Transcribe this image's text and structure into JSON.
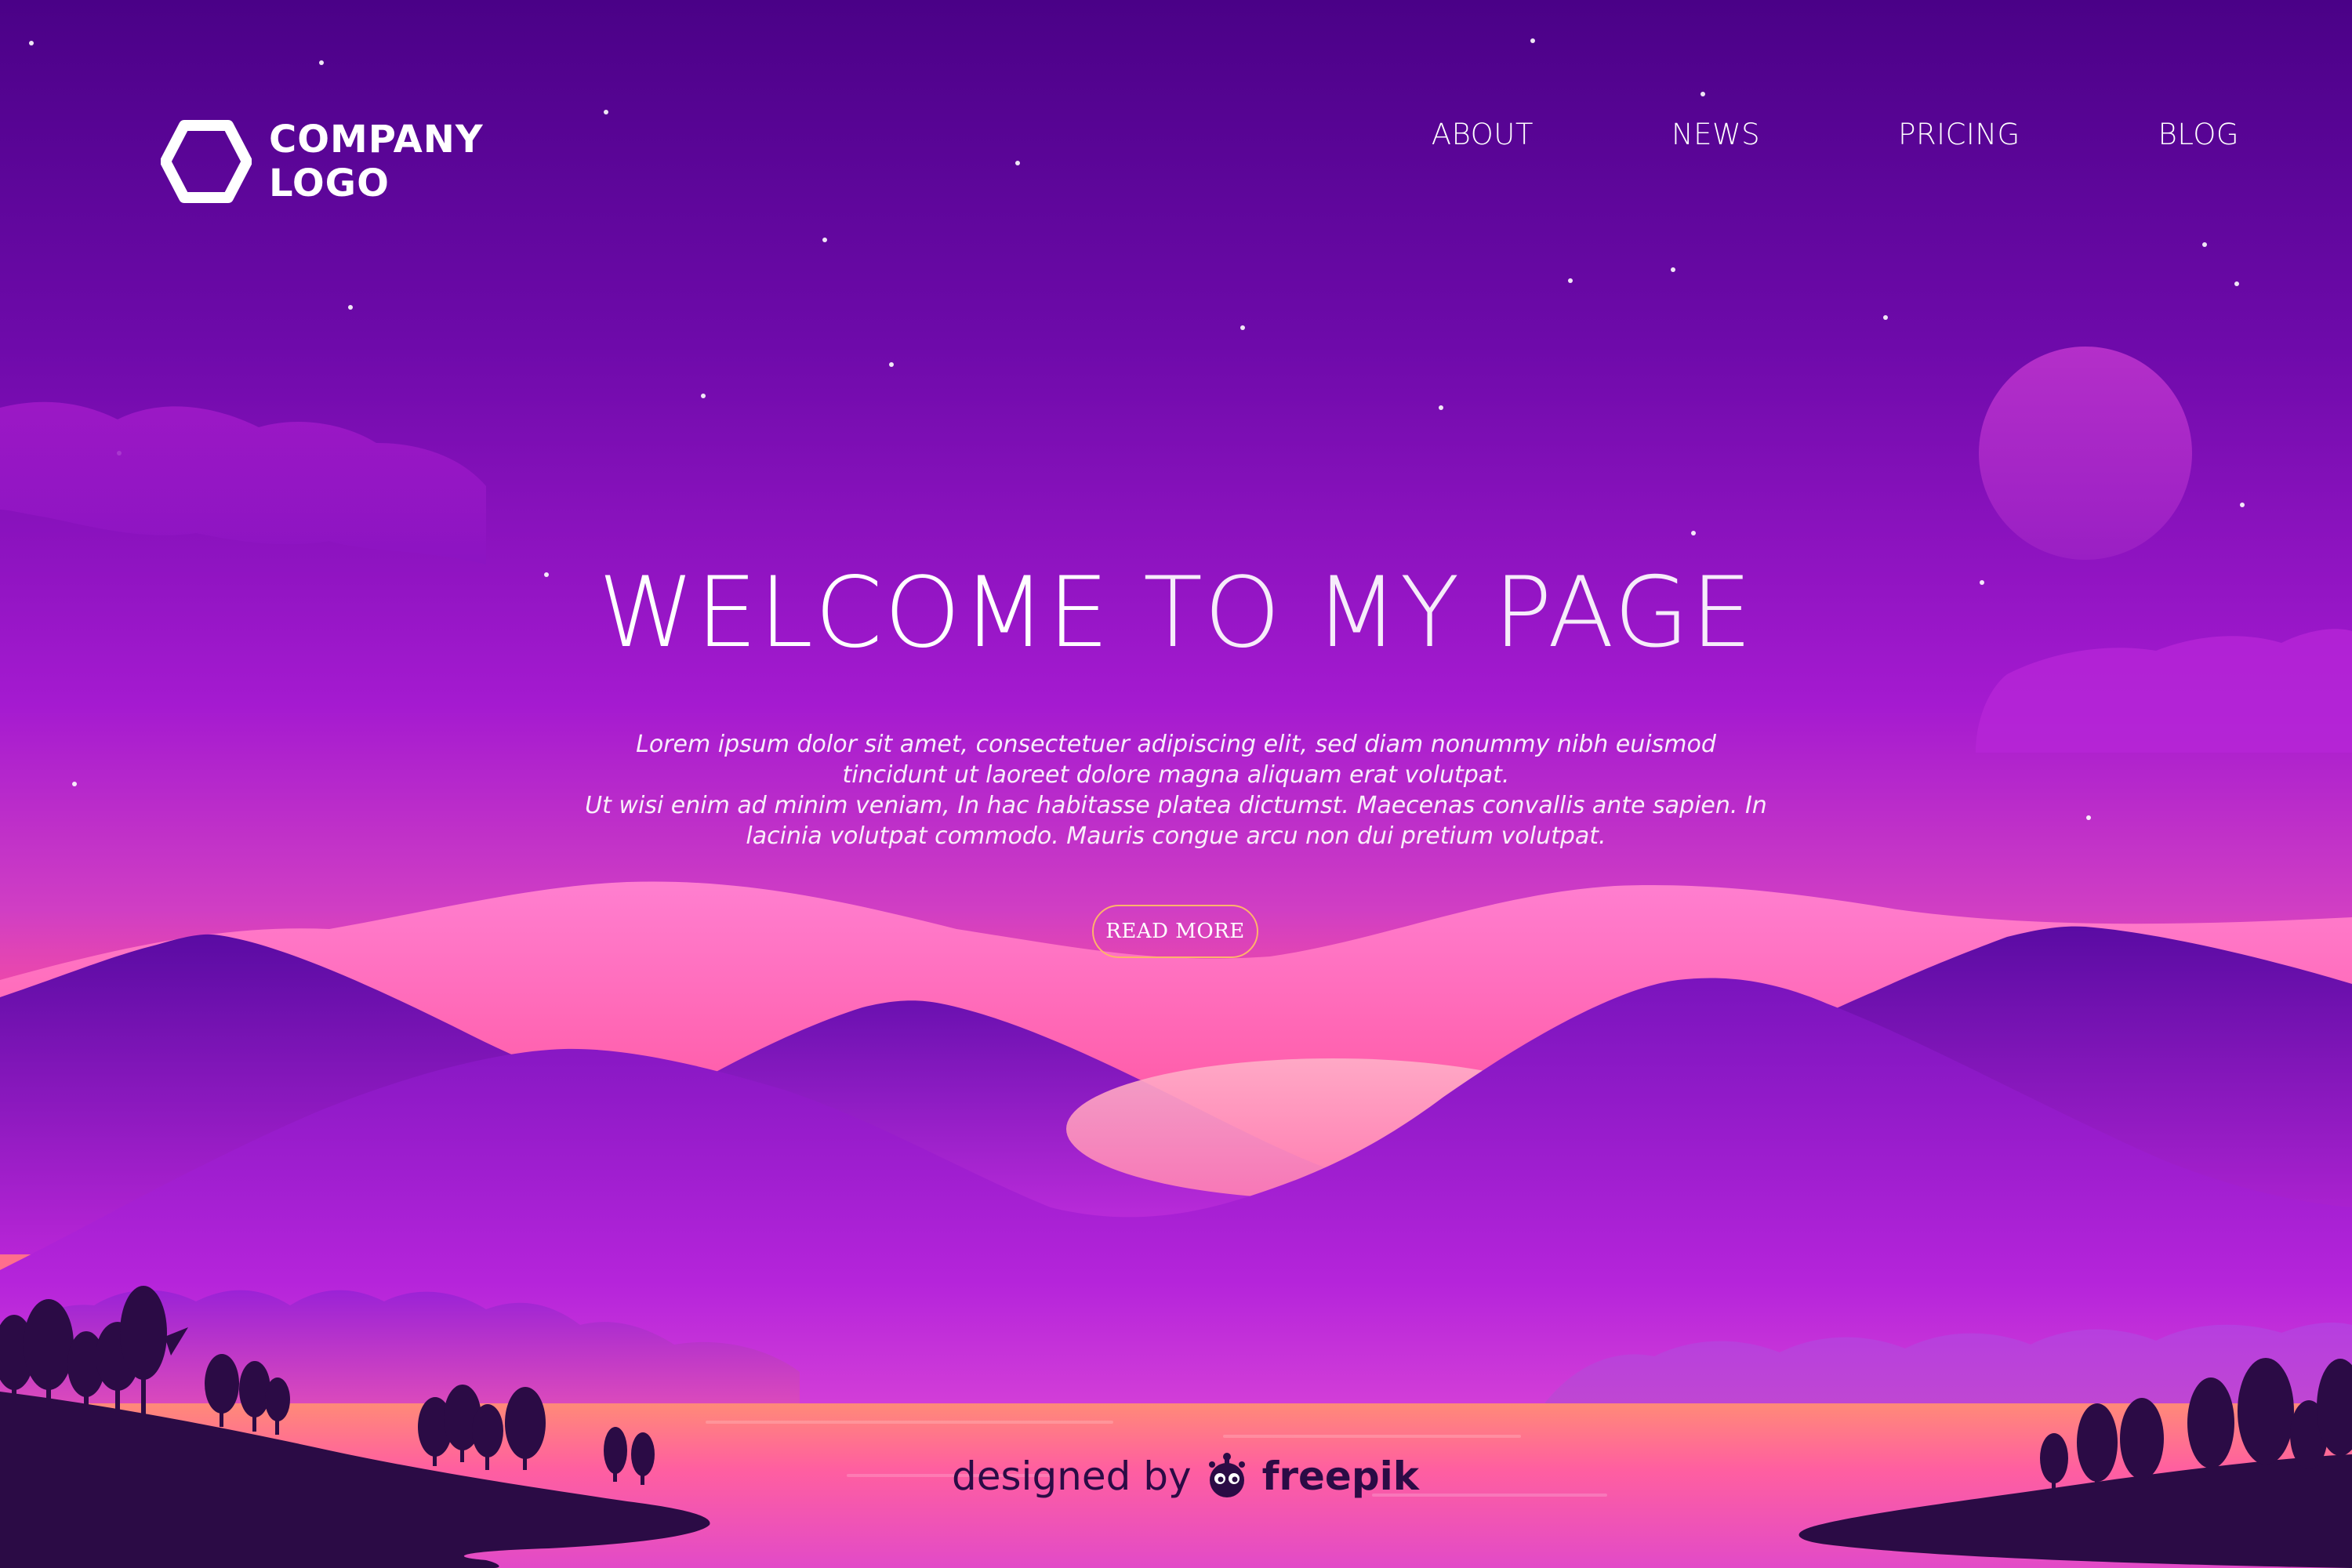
{
  "logo": {
    "line1": "COMPANY",
    "line2": "LOGO",
    "icon": "hexagon-icon"
  },
  "nav": {
    "items": [
      "ABOUT",
      "NEWS",
      "PRICING",
      "BLOG"
    ]
  },
  "hero": {
    "title_bold": "WELCOME",
    "title_light": "TO MY PAGE",
    "body_line1": "Lorem ipsum dolor sit amet, consectetuer adipiscing elit, sed diam nonummy nibh euismod",
    "body_line2": "tincidunt ut laoreet dolore magna aliquam erat volutpat.",
    "body_line3": "Ut wisi enim ad minim veniam, In hac habitasse platea dictumst. Maecenas convallis ante sapien. In",
    "body_line4": "lacinia volutpat commodo. Mauris congue arcu non dui pretium volutpat.",
    "button_label": "READ MORE"
  },
  "credit": {
    "prefix": "designed by",
    "brand": "freepik",
    "icon": "freepik-icon"
  },
  "colors": {
    "sky_top": "#4a0187",
    "sky_mid": "#a51ad0",
    "sky_glow": "#ff4f9a",
    "mountain_dark": "#5a0ba3",
    "silhouette": "#2b0b45",
    "button_border": "#ffb36b"
  }
}
